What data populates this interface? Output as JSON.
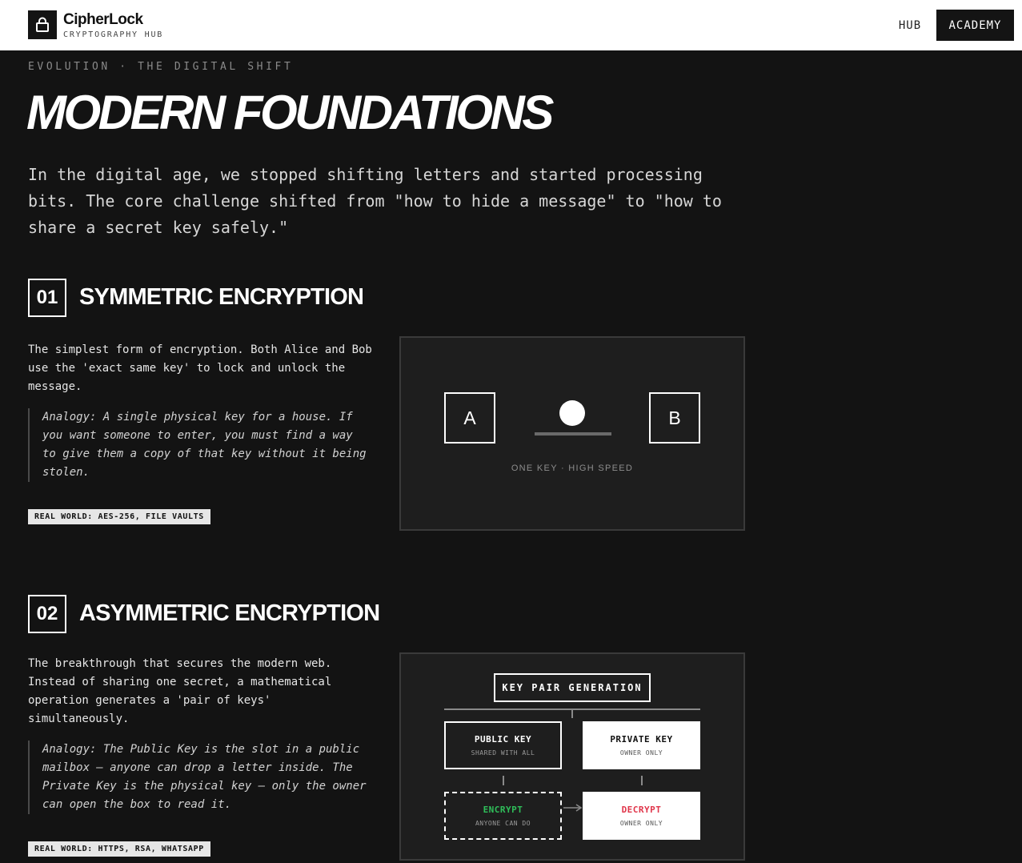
{
  "header": {
    "brand_name": "CipherLock",
    "brand_sub": "CRYPTOGRAPHY HUB",
    "logo_icon": "lock-icon",
    "nav": {
      "hub": "HUB",
      "academy": "ACADEMY"
    }
  },
  "hero": {
    "eyebrow": "EVOLUTION · THE DIGITAL SHIFT",
    "title": "MODERN FOUNDATIONS",
    "intro": "In the digital age, we stopped shifting letters and started processing bits. The core challenge shifted from \"how to hide a message\" to \"how to share a secret key safely.\""
  },
  "sections": [
    {
      "number": "01",
      "title": "SYMMETRIC ENCRYPTION",
      "description": "The simplest form of encryption. Both Alice and Bob use the 'exact same key' to lock and unlock the message.",
      "analogy": "Analogy: A single physical key for a house. If you want someone to enter, you must find a way to give them a copy of that key without it being stolen.",
      "tag": "REAL WORLD: AES-256, FILE VAULTS",
      "diagram": {
        "party_a": "A",
        "party_b": "B",
        "caption": "ONE KEY · HIGH SPEED"
      }
    },
    {
      "number": "02",
      "title": "ASYMMETRIC ENCRYPTION",
      "description": "The breakthrough that secures the modern web. Instead of sharing one secret, a mathematical operation generates a 'pair of keys' simultaneously.",
      "analogy": "Analogy: The Public Key is the slot in a public mailbox — anyone can drop a letter inside. The Private Key is the physical key — only the owner can open the box to read it.",
      "tag": "REAL WORLD: HTTPS, RSA, WHATSAPP",
      "diagram": {
        "root": "KEY PAIR GENERATION",
        "public_key": {
          "title": "PUBLIC KEY",
          "sub": "SHARED WITH ALL"
        },
        "private_key": {
          "title": "PRIVATE KEY",
          "sub": "OWNER ONLY"
        },
        "encrypt": {
          "title": "ENCRYPT",
          "sub": "ANYONE CAN DO"
        },
        "decrypt": {
          "title": "DECRYPT",
          "sub": "OWNER ONLY"
        }
      }
    }
  ],
  "colors": {
    "background": "#131313",
    "panel": "#1e1e1e",
    "encrypt_green": "#2fbf5a",
    "decrypt_red": "#e0354a"
  }
}
